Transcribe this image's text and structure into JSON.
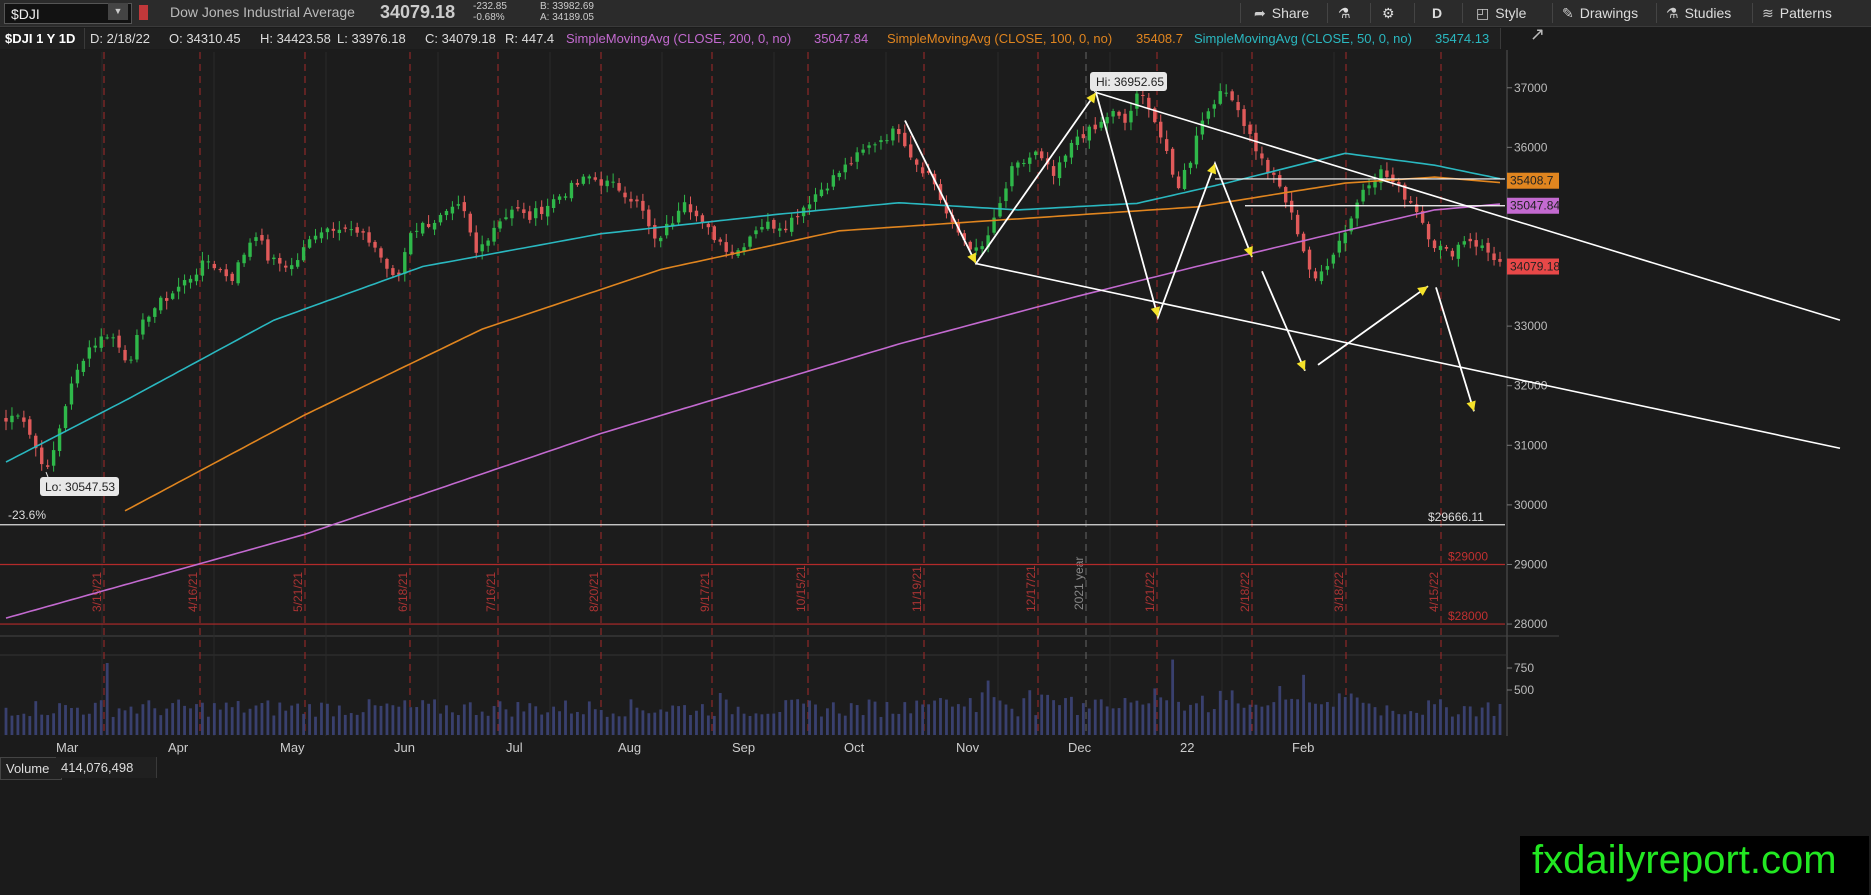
{
  "toolbar": {
    "symbol": "$DJI",
    "name": "Dow Jones Industrial Average",
    "last": "34079.18",
    "change": "-232.85",
    "change_pct": "-0.68%",
    "bid": "B: 33982.69",
    "ask": "A: 34189.05",
    "buttons": {
      "share": "Share",
      "aggregation": "D",
      "style": "Style",
      "drawings": "Drawings",
      "studies": "Studies",
      "patterns": "Patterns"
    }
  },
  "info_bar": {
    "symbol_period": "$DJI 1 Y 1D",
    "date": "D: 2/18/22",
    "open": "O: 34310.45",
    "high": "H: 34423.58",
    "low": "L: 33976.18",
    "close": "C: 34079.18",
    "range": "R: 447.4",
    "sma200_label": "SimpleMovingAvg (CLOSE, 200, 0, no)",
    "sma200_value": "35047.84",
    "sma100_label": "SimpleMovingAvg (CLOSE, 100, 0, no)",
    "sma100_value": "35408.7",
    "sma50_label": "SimpleMovingAvg (CLOSE, 50, 0, no)",
    "sma50_value": "35474.13"
  },
  "volume_bar": {
    "label": "Volume",
    "value": "414,076,498"
  },
  "watermark": "fxdailyreport.com",
  "colors": {
    "sma200": "#c36ad0",
    "sma100": "#e0851f",
    "sma50": "#2ab8c0",
    "up": "#2fb84a",
    "down": "#e05a5a",
    "brand": "#22e822"
  },
  "chart_data": {
    "type": "candlestick",
    "y_axis": {
      "ticks": [
        28000,
        29000,
        30000,
        31000,
        32000,
        33000,
        34000,
        35000,
        36000,
        37000
      ],
      "range": [
        27850,
        37600
      ]
    },
    "x_axis": {
      "months": [
        "Mar",
        "Apr",
        "May",
        "Jun",
        "Jul",
        "Aug",
        "Sep",
        "Oct",
        "Nov",
        "Dec",
        "22",
        "Feb"
      ],
      "vertical_date_labels": [
        "3/19/21",
        "4/16/21",
        "5/21/21",
        "6/18/21",
        "7/16/21",
        "8/20/21",
        "9/17/21",
        "10/15/21",
        "11/19/21",
        "12/17/21",
        "2021 year",
        "1/21/22",
        "2/18/22",
        "3/18/22",
        "4/15/22"
      ]
    },
    "annotations": {
      "high": "Hi: 36952.65",
      "low": "Lo: 30547.53",
      "fib": "-23.6%",
      "level_29666": "$29666.11",
      "level_29000": "$29000",
      "level_28000": "$28000",
      "price_tag_sma100": "35408.7",
      "price_tag_sma200": "35047.84",
      "price_tag_last": "34079.18"
    },
    "sma_keypoints": {
      "sma50": [
        [
          0,
          30720
        ],
        [
          20,
          31750
        ],
        [
          45,
          33100
        ],
        [
          70,
          34000
        ],
        [
          100,
          34550
        ],
        [
          130,
          34880
        ],
        [
          150,
          35070
        ],
        [
          170,
          34950
        ],
        [
          190,
          35060
        ],
        [
          205,
          35400
        ],
        [
          225,
          35900
        ],
        [
          240,
          35700
        ],
        [
          251,
          35474
        ]
      ],
      "sma100": [
        [
          20,
          29900
        ],
        [
          50,
          31500
        ],
        [
          80,
          32950
        ],
        [
          110,
          33950
        ],
        [
          140,
          34600
        ],
        [
          170,
          34800
        ],
        [
          200,
          35000
        ],
        [
          225,
          35400
        ],
        [
          240,
          35500
        ],
        [
          251,
          35409
        ]
      ],
      "sma200": [
        [
          0,
          28100
        ],
        [
          50,
          29500
        ],
        [
          100,
          31200
        ],
        [
          150,
          32700
        ],
        [
          180,
          33500
        ],
        [
          200,
          34000
        ],
        [
          225,
          34600
        ],
        [
          240,
          34950
        ],
        [
          251,
          35048
        ]
      ]
    },
    "volume_axis_ticks": [
      "750",
      "500"
    ]
  }
}
